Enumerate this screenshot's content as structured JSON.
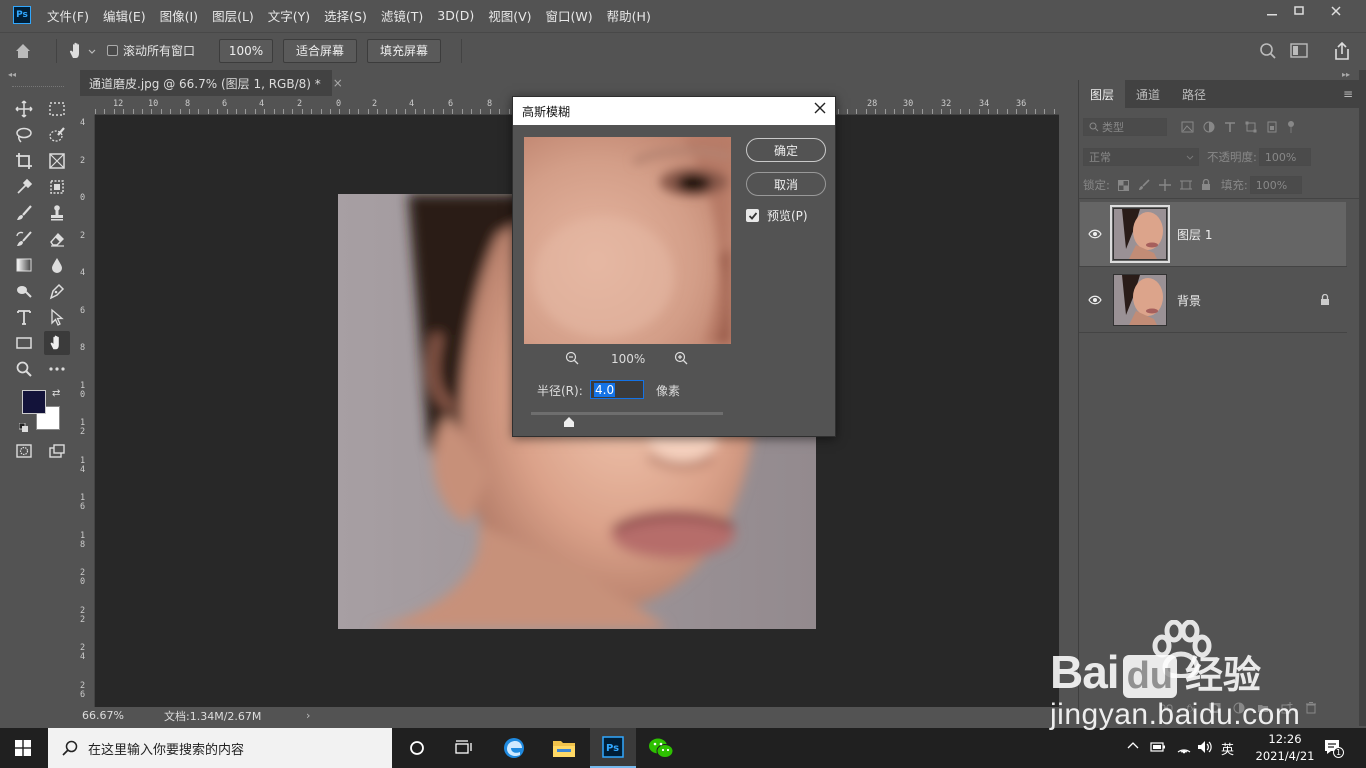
{
  "menubar": {
    "logo": "Ps",
    "items": [
      "文件(F)",
      "编辑(E)",
      "图像(I)",
      "图层(L)",
      "文字(Y)",
      "选择(S)",
      "滤镜(T)",
      "3D(D)",
      "视图(V)",
      "窗口(W)",
      "帮助(H)"
    ]
  },
  "options": {
    "scroll_all": "滚动所有窗口",
    "zoom_value": "100%",
    "fit_screen": "适合屏幕",
    "fill_screen": "填充屏幕"
  },
  "document": {
    "tab_title": "通道磨皮.jpg @ 66.7% (图层 1, RGB/8) *",
    "tab_close": "×",
    "ruler_top_labels": [
      "12",
      "10",
      "8",
      "6",
      "4",
      "2",
      "0",
      "2",
      "4",
      "6",
      "8",
      "28",
      "30",
      "32",
      "34",
      "36"
    ],
    "ruler_left_labels": [
      "4",
      "2",
      "0",
      "2",
      "4",
      "6",
      "8",
      "1\n0",
      "1\n2",
      "1\n4",
      "1\n6",
      "1\n8",
      "2\n0",
      "2\n2",
      "2\n4",
      "2\n6"
    ]
  },
  "status": {
    "zoom": "66.67%",
    "doc_size": "文档:1.34M/2.67M",
    "arrow": "›"
  },
  "layers_panel": {
    "tabs": [
      "图层",
      "通道",
      "路径"
    ],
    "filter_kind": "类型",
    "blend_mode": "正常",
    "opacity_label": "不透明度:",
    "opacity_value": "100%",
    "lock_label": "锁定:",
    "fill_label": "填充:",
    "fill_value": "100%",
    "layers": [
      {
        "name": "图层 1",
        "visible": true,
        "selected": true,
        "locked": false
      },
      {
        "name": "背景",
        "visible": true,
        "selected": false,
        "locked": true
      }
    ]
  },
  "dialog": {
    "title": "高斯模糊",
    "ok": "确定",
    "cancel": "取消",
    "preview_label": "预览(P)",
    "preview_checked": true,
    "zoom_level": "100%",
    "radius_label": "半径(R):",
    "radius_value": "4.0",
    "unit": "像素",
    "slider_fraction": 0.2
  },
  "taskbar": {
    "search_placeholder": "在这里输入你要搜索的内容",
    "time": "12:26",
    "date": "2021/4/21",
    "ime": "英",
    "notification_count": "1"
  },
  "watermark": {
    "brand": "Bai",
    "brand2": "du",
    "cn": "经验",
    "url": "jingyan.baidu.com"
  },
  "colors": {
    "ps_blue": "#31a8ff",
    "selection_blue": "#1473e6",
    "foreground_color": "#13133a",
    "background_color": "#ffffff"
  }
}
